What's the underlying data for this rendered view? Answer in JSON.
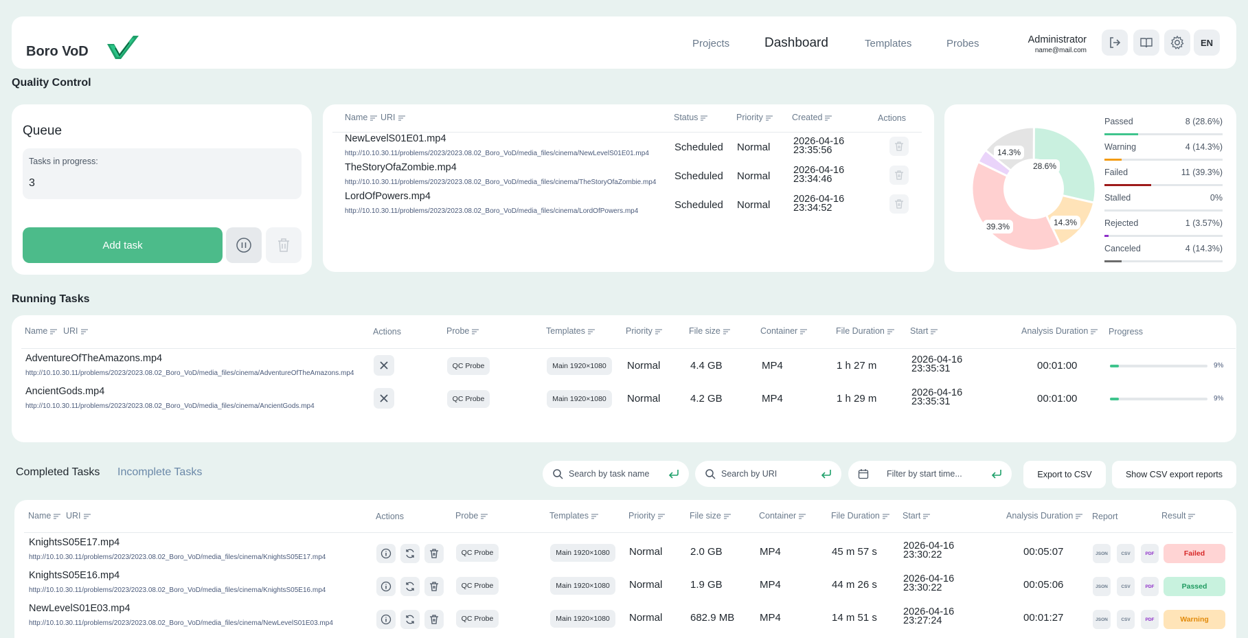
{
  "app": {
    "name": "Boro VoD"
  },
  "nav": {
    "projects": "Projects",
    "dashboard": "Dashboard",
    "templates": "Templates",
    "probes": "Probes"
  },
  "user": {
    "name": "Administrator",
    "email": "name@mail.com"
  },
  "header_icons": [
    "logout-icon",
    "book-icon",
    "gear-icon"
  ],
  "language": "EN",
  "page_title": "Quality Control",
  "queue": {
    "title": "Queue",
    "tasks_label": "Tasks in progress:",
    "tasks_value": "3",
    "add_task": "Add task",
    "headers": {
      "name": "Name",
      "uri": "URI",
      "status": "Status",
      "priority": "Priority",
      "created": "Created",
      "actions": "Actions"
    },
    "rows": [
      {
        "name": "NewLevelS01E01.mp4",
        "uri": "http://10.10.30.11/problems/2023/2023.08.02_Boro_VoD/media_files/cinema/NewLevelS01E01.mp4",
        "status": "Scheduled",
        "priority": "Normal",
        "date": "2026-04-16",
        "time": "23:35:56"
      },
      {
        "name": "TheStoryOfaZombie.mp4",
        "uri": "http://10.10.30.11/problems/2023/2023.08.02_Boro_VoD/media_files/cinema/TheStoryOfaZombie.mp4",
        "status": "Scheduled",
        "priority": "Normal",
        "date": "2026-04-16",
        "time": "23:34:46"
      },
      {
        "name": "LordOfPowers.mp4",
        "uri": "http://10.10.30.11/problems/2023/2023.08.02_Boro_VoD/media_files/cinema/LordOfPowers.mp4",
        "status": "Scheduled",
        "priority": "Normal",
        "date": "2026-04-16",
        "time": "23:34:52"
      }
    ]
  },
  "stats": {
    "slice_labels": [
      "28.6%",
      "14.3%",
      "39.3%",
      "14.3%"
    ],
    "items": [
      {
        "label": "Passed",
        "value": "8 (28.6%)",
        "fraction": 0.286,
        "color": "#3fc48d"
      },
      {
        "label": "Warning",
        "value": "4 (14.3%)",
        "fraction": 0.143,
        "color": "#f39c12"
      },
      {
        "label": "Failed",
        "value": "11 (39.3%)",
        "fraction": 0.393,
        "color": "#9e1a1a"
      },
      {
        "label": "Stalled",
        "value": "0%",
        "fraction": 0,
        "color": "#8a8a8a"
      },
      {
        "label": "Rejected",
        "value": "1 (3.57%)",
        "fraction": 0.0357,
        "color": "#8e2fc8"
      },
      {
        "label": "Canceled",
        "value": "4 (14.3%)",
        "fraction": 0.143,
        "color": "#6b6b6b"
      }
    ]
  },
  "running": {
    "title": "Running Tasks",
    "headers": {
      "name": "Name",
      "uri": "URI",
      "actions": "Actions",
      "probe": "Probe",
      "templates": "Templates",
      "priority": "Priority",
      "file_size": "File size",
      "container": "Container",
      "file_duration": "File Duration",
      "start": "Start",
      "analysis_duration": "Analysis Duration",
      "progress": "Progress"
    },
    "rows": [
      {
        "name": "AdventureOfTheAmazons.mp4",
        "uri": "http://10.10.30.11/problems/2023/2023.08.02_Boro_VoD/media_files/cinema/AdventureOfTheAmazons.mp4",
        "probe": "QC Probe",
        "template": "Main 1920×1080",
        "priority": "Normal",
        "size": "4.4 GB",
        "container": "MP4",
        "duration": "1 h 27 m",
        "date": "2026-04-16",
        "time": "23:35:31",
        "analysis": "00:01:00",
        "progress": 0.09,
        "progress_label": "9%"
      },
      {
        "name": "AncientGods.mp4",
        "uri": "http://10.10.30.11/problems/2023/2023.08.02_Boro_VoD/media_files/cinema/AncientGods.mp4",
        "probe": "QC Probe",
        "template": "Main 1920×1080",
        "priority": "Normal",
        "size": "4.2 GB",
        "container": "MP4",
        "duration": "1 h 29 m",
        "date": "2026-04-16",
        "time": "23:35:31",
        "analysis": "00:01:00",
        "progress": 0.09,
        "progress_label": "9%"
      }
    ]
  },
  "completed": {
    "tab_completed": "Completed Tasks",
    "tab_incomplete": "Incomplete Tasks",
    "search_name": "Search by task name",
    "search_uri": "Search by URI",
    "filter_start": "Filter by start time...",
    "export_csv": "Export to CSV",
    "show_reports": "Show CSV export reports",
    "headers": {
      "name": "Name",
      "uri": "URI",
      "actions": "Actions",
      "probe": "Probe",
      "templates": "Templates",
      "priority": "Priority",
      "file_size": "File size",
      "container": "Container",
      "file_duration": "File Duration",
      "start": "Start",
      "analysis_duration": "Analysis Duration",
      "report": "Report",
      "result": "Result"
    },
    "report_types": [
      "JSON",
      "CSV",
      "PDF"
    ],
    "rows": [
      {
        "name": "KnightsS05E17.mp4",
        "uri": "http://10.10.30.11/problems/2023/2023.08.02_Boro_VoD/media_files/cinema/KnightsS05E17.mp4",
        "probe": "QC Probe",
        "template": "Main 1920×1080",
        "priority": "Normal",
        "size": "2.0 GB",
        "container": "MP4",
        "duration": "45 m 57 s",
        "date": "2026-04-16",
        "time": "23:30:22",
        "analysis": "00:05:07",
        "result": "Failed",
        "result_bg": "#ffd4d4",
        "result_color": "#d62828"
      },
      {
        "name": "KnightsS05E16.mp4",
        "uri": "http://10.10.30.11/problems/2023/2023.08.02_Boro_VoD/media_files/cinema/KnightsS05E16.mp4",
        "probe": "QC Probe",
        "template": "Main 1920×1080",
        "priority": "Normal",
        "size": "1.9 GB",
        "container": "MP4",
        "duration": "44 m 26 s",
        "date": "2026-04-16",
        "time": "23:30:22",
        "analysis": "00:05:06",
        "result": "Passed",
        "result_bg": "#c8f2de",
        "result_color": "#1f9a60"
      },
      {
        "name": "NewLevelS01E03.mp4",
        "uri": "http://10.10.30.11/problems/2023/2023.08.02_Boro_VoD/media_files/cinema/NewLevelS01E03.mp4",
        "probe": "QC Probe",
        "template": "Main 1920×1080",
        "priority": "Normal",
        "size": "682.9 MB",
        "container": "MP4",
        "duration": "14 m 51 s",
        "date": "2026-04-16",
        "time": "23:27:24",
        "analysis": "00:01:27",
        "result": "Warning",
        "result_bg": "#ffe4b8",
        "result_color": "#e28a0a"
      }
    ]
  }
}
